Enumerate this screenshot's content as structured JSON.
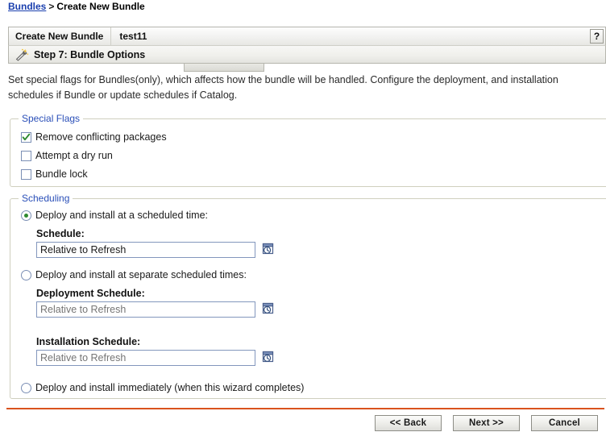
{
  "breadcrumb": {
    "link_label": "Bundles",
    "separator": ">",
    "current_label": "Create New Bundle"
  },
  "wizard": {
    "title_label": "Create New Bundle",
    "bundle_name": "test11",
    "help_label": "?",
    "step_label": "Step 7: Bundle Options",
    "wand_icon": "magic-wand-icon",
    "help_icon": "question-mark-icon"
  },
  "description": "Set special flags for Bundles(only), which affects how the bundle will be handled. Configure the deployment, and installation schedules if Bundle or update schedules if Catalog.",
  "special_flags": {
    "legend": "Special Flags",
    "items": [
      {
        "label": "Remove conflicting packages",
        "checked": true
      },
      {
        "label": "Attempt a dry run",
        "checked": false
      },
      {
        "label": "Bundle lock",
        "checked": false
      }
    ]
  },
  "scheduling": {
    "legend": "Scheduling",
    "option_scheduled_time": {
      "label": "Deploy and install at a scheduled time:",
      "selected": true
    },
    "schedule_field": {
      "label": "Schedule:",
      "value": "Relative to Refresh",
      "placeholder": "Relative to Refresh",
      "disabled": false,
      "picker_icon": "calendar-clock-icon"
    },
    "option_separate_times": {
      "label": "Deploy and install at separate scheduled times:",
      "selected": false
    },
    "deployment_schedule_field": {
      "label": "Deployment Schedule:",
      "value": "",
      "placeholder": "Relative to Refresh",
      "disabled": true,
      "picker_icon": "calendar-clock-icon"
    },
    "installation_schedule_field": {
      "label": "Installation Schedule:",
      "value": "",
      "placeholder": "Relative to Refresh",
      "disabled": true,
      "picker_icon": "calendar-clock-icon"
    },
    "option_immediately": {
      "label": "Deploy and install immediately (when this wizard completes)",
      "selected": false
    }
  },
  "footer": {
    "back_label": "<< Back",
    "next_label": "Next >>",
    "cancel_label": "Cancel"
  },
  "colors": {
    "accent_orange": "#d9531e",
    "legend_blue": "#2a4fb8",
    "link_blue": "#1a3fae",
    "check_green": "#2f8a2f"
  }
}
